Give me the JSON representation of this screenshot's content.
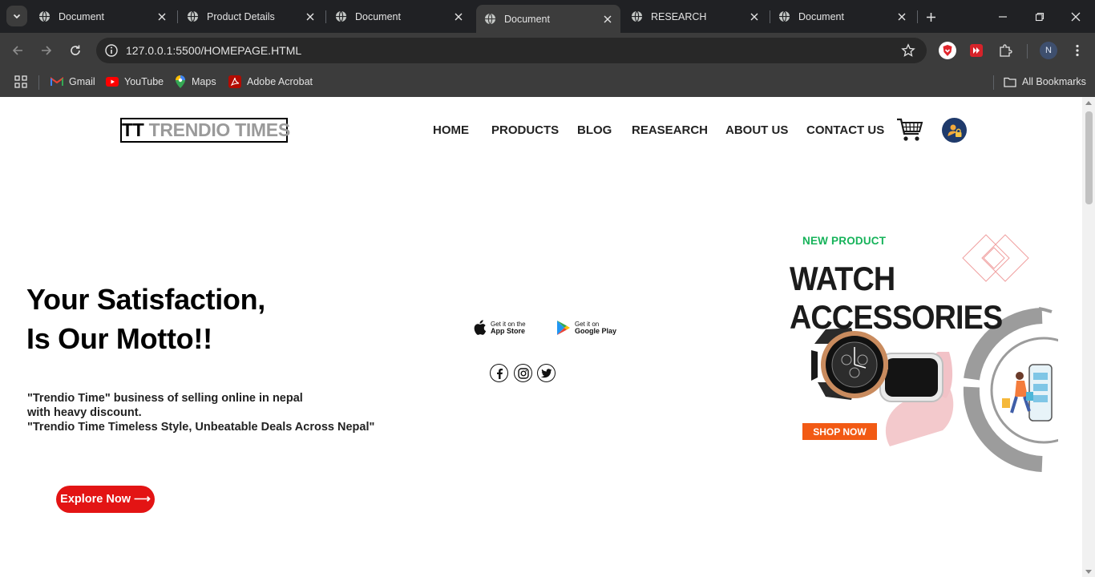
{
  "browser": {
    "tabs": [
      {
        "title": "Document",
        "active": false
      },
      {
        "title": "Product Details",
        "active": false
      },
      {
        "title": "Document",
        "active": false
      },
      {
        "title": "Document",
        "active": true
      },
      {
        "title": "RESEARCH",
        "active": false
      },
      {
        "title": "Document",
        "active": false
      }
    ],
    "url": "127.0.0.1:5500/HOMEPAGE.HTML",
    "profile_initial": "N",
    "bookmarks": [
      "Gmail",
      "YouTube",
      "Maps",
      "Adobe Acrobat"
    ],
    "all_bookmarks_label": "All Bookmarks"
  },
  "header": {
    "logo_mark": "TT",
    "logo_text": "TRENDIO TIMES",
    "nav": [
      "HOME",
      "PRODUCTS",
      "BLOG",
      "REASEARCH",
      "ABOUT US",
      "CONTACT US"
    ]
  },
  "hero": {
    "title_line1": "Your Satisfaction,",
    "title_line2": "Is Our Motto!!",
    "desc_line1": "\"Trendio Time\" business of selling online in nepal",
    "desc_line2": "with heavy discount.",
    "desc_line3": "\"Trendio Time Timeless Style, Unbeatable Deals Across Nepal\"",
    "cta": "Explore Now ⟶"
  },
  "apps": {
    "appstore_small": "Get it on the",
    "appstore_big": "App Store",
    "googleplay_small": "Get it on",
    "googleplay_big": "Google Play"
  },
  "social": [
    "facebook-icon",
    "instagram-icon",
    "twitter-icon"
  ],
  "promo": {
    "label": "NEW PRODUCT",
    "title_line1": "WATCH",
    "title_line2": "ACCESSORIES",
    "cta": "SHOP NOW"
  },
  "colors": {
    "accent_red": "#e31414",
    "promo_green": "#16b35a",
    "promo_orange": "#f25a14",
    "logo_gray": "#9a9a9a"
  }
}
